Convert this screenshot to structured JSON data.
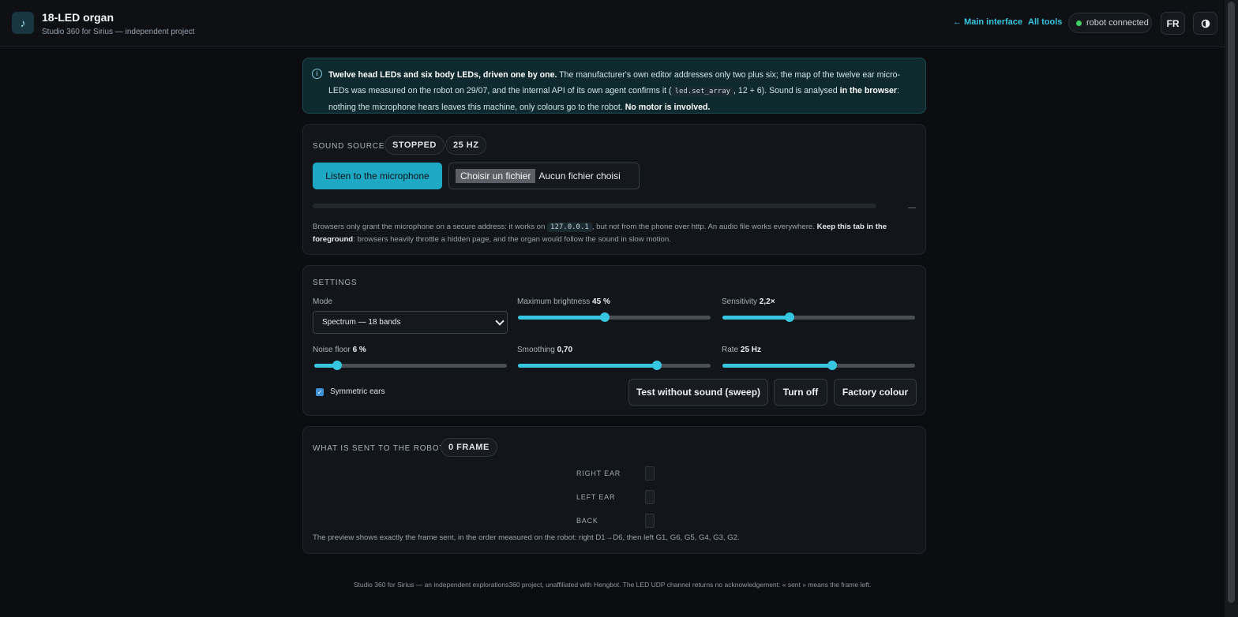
{
  "header": {
    "logo_glyph": "♪",
    "title": "18-LED organ",
    "subtitle": "Studio 360 for Sirius — independent project",
    "main_link": "← Main interface",
    "tools_link": "All tools",
    "status": "robot connected",
    "lang_button": "FR",
    "theme_icon": "contrast-icon"
  },
  "info": {
    "icon": "ⓘ",
    "lead": "Twelve head LEDs and six body LEDs, driven one by one.",
    "text1": " The manufacturer's own editor addresses only two plus six; the map of the twelve ear micro-LEDs was measured on the robot on 29/07, and the internal API of its own agent confirms it (",
    "code": "led.set_array",
    "text2": ", 12 + 6). Sound is analysed ",
    "bold2": "in the browser",
    "text3": ": nothing the microphone hears leaves this machine, only colours go to the robot. ",
    "bold3": "No motor is involved."
  },
  "source": {
    "title": "SOUND SOURCE",
    "state_badge": "STOPPED",
    "rate_badge": "25 HZ",
    "mic_button": "Listen to the microphone",
    "file_button": "Choisir un fichier",
    "file_status": "Aucun fichier choisi",
    "level": 0,
    "level_value": "—",
    "note1": "Browsers only grant the microphone on a secure address: it works on ",
    "note_code": "127.0.0.1",
    "note2": ", but not from the phone over http. An audio file works everywhere. ",
    "note_bold": "Keep this tab in the foreground",
    "note3": ": browsers heavily throttle a hidden page, and the organ would follow the sound in slow motion."
  },
  "settings": {
    "title": "SETTINGS",
    "mode_label": "Mode",
    "mode_value": "Spectrum — 18 bands",
    "brightness_label": "Maximum brightness",
    "brightness_value": "45 %",
    "brightness_pct": 0.45,
    "sensitivity_label": "Sensitivity",
    "sensitivity_value": "2,2×",
    "sensitivity_pct": 0.35,
    "noise_label": "Noise floor",
    "noise_value": "6 %",
    "noise_pct": 0.12,
    "smoothing_label": "Smoothing",
    "smoothing_value": "0,70",
    "smoothing_pct": 0.72,
    "rate_label": "Rate",
    "rate_value": "25 Hz",
    "rate_pct": 0.57,
    "symmetric_label": "Symmetric ears",
    "symmetric_checked": true,
    "check_glyph": "✓",
    "sweep_button": "Test without sound (sweep)",
    "off_button": "Turn off",
    "factory_button": "Factory colour"
  },
  "preview": {
    "title": "WHAT IS SENT TO THE ROBOT",
    "frame_badge": "0 FRAME",
    "rows": [
      "RIGHT EAR",
      "LEFT EAR",
      "BACK"
    ],
    "note": "The preview shows exactly the frame sent, in the order measured on the robot: right D1→D6, then left G1, G6, G5, G4, G3, G2."
  },
  "footer": {
    "text": "Studio 360 for Sirius — an independent explorations360 project, unaffiliated with Hengbot. The LED UDP channel returns no acknowledgement: « sent » means the frame left."
  }
}
